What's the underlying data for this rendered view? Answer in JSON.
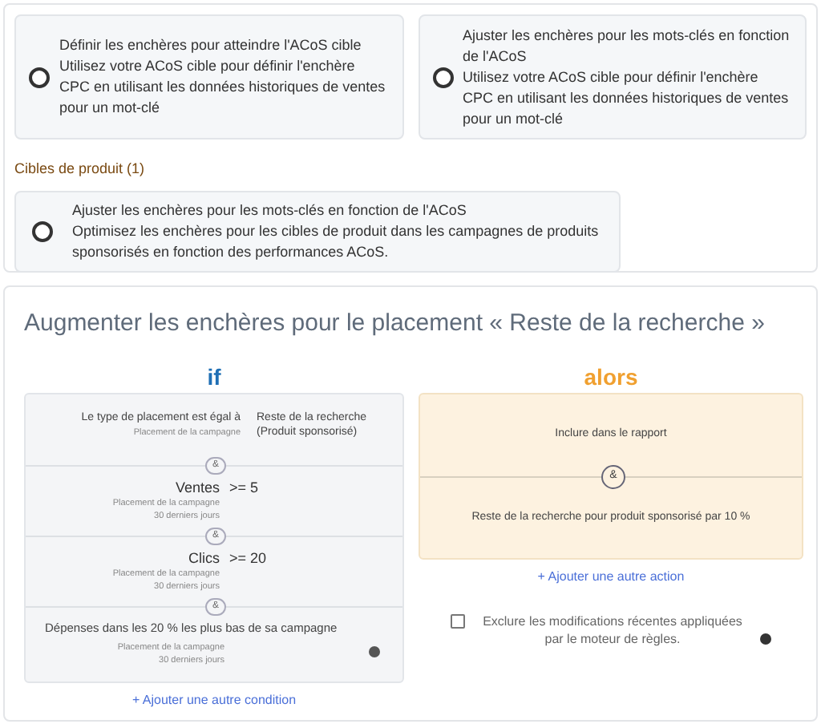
{
  "option_groups": [
    {
      "options": [
        {
          "title": "Définir les enchères pour atteindre l'ACoS cible",
          "description": "Utilisez votre ACoS cible pour définir l'enchère CPC en utilisant les données historiques de ventes pour un mot-clé",
          "selected": false
        },
        {
          "title": "Ajuster les enchères pour les mots-clés en fonction de l'ACoS",
          "description": "Utilisez votre ACoS cible pour définir l'enchère CPC en utilisant les données historiques de ventes pour un mot-clé",
          "selected": false
        }
      ]
    },
    {
      "heading": "Cibles de produit (1)",
      "options": [
        {
          "title": "Ajuster les enchères pour les mots-clés en fonction de l'ACoS",
          "description": "Optimisez les enchères pour les cibles de produit dans les campagnes de produits sponsorisés en fonction des performances ACoS.",
          "selected": false
        }
      ]
    }
  ],
  "rule": {
    "title": "Augmenter les enchères pour le placement « Reste de la recherche »",
    "if_label": "if",
    "then_label": "alors",
    "conditions": [
      {
        "kind": "pair",
        "label": "Le type de placement est égal à",
        "sub": [
          "Placement de la campagne"
        ],
        "value": "Reste de la recherche (Produit sponsorisé)"
      },
      {
        "kind": "metric",
        "joiner": "&",
        "label": "Ventes",
        "operator": ">= 5",
        "sub": [
          "Placement de la campagne",
          "30 derniers jours"
        ]
      },
      {
        "kind": "metric",
        "joiner": "&",
        "label": "Clics",
        "operator": ">= 20",
        "sub": [
          "Placement de la campagne",
          "30 derniers jours"
        ]
      },
      {
        "kind": "full",
        "joiner": "&",
        "label": "Dépenses dans les 20 % les plus bas de sa campagne",
        "sub": [
          "Placement de la campagne",
          "30 derniers jours"
        ]
      }
    ],
    "add_condition": "+ Ajouter une autre condition",
    "actions": [
      {
        "text": "Inclure dans le rapport"
      },
      {
        "joiner": "&",
        "text": "Reste de la recherche pour produit sponsorisé par 10 %"
      }
    ],
    "add_action": "+ Ajouter une autre action",
    "exclude": {
      "label": "Exclure les modifications récentes appliquées par le moteur de règles.",
      "checked": false
    }
  }
}
